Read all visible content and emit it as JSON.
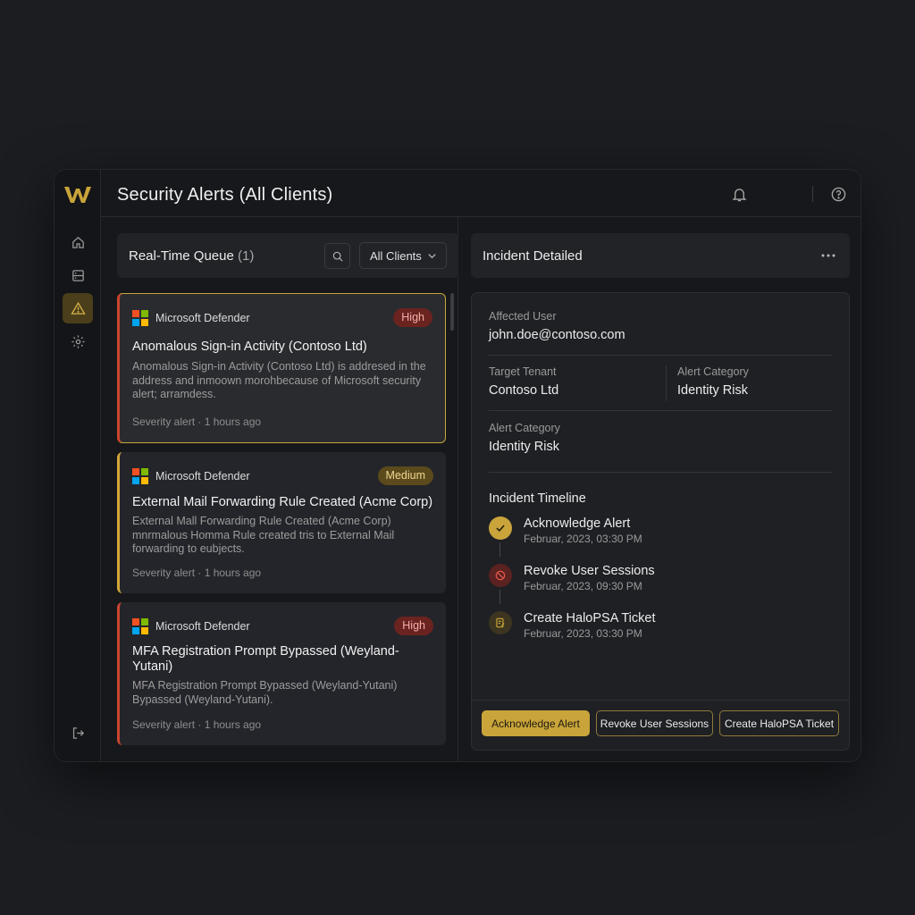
{
  "header": {
    "title": "Security Alerts (All Clients)"
  },
  "queue": {
    "title": "Real-Time Queue",
    "count": "(1)",
    "filter_value": "All Clients"
  },
  "alerts": [
    {
      "vendor": "Microsoft Defender",
      "severity": "High",
      "title": "Anomalous Sign-in Activity (Contoso Ltd)",
      "description": "Anomalous Sign-in Activity (Contoso Ltd) is addresed in the address and inmoown morohbecause of Microsoft security alert; arramdess.",
      "meta": "Severity alert · 1 hours ago"
    },
    {
      "vendor": "Microsoft Defender",
      "severity": "Medium",
      "title": "External Mail Forwarding Rule Created (Acme Corp)",
      "description": "External Mall Forwarding Rule Created (Acme Corp) mnrmalous Homma Rule created tris to External Mail forwarding to eubjects.",
      "meta": "Severity alert · 1 hours ago"
    },
    {
      "vendor": "Microsoft Defender",
      "severity": "High",
      "title": "MFA Registration Prompt Bypassed (Weyland-Yutani)",
      "description": "MFA Registration Prompt Bypassed (Weyland-Yutani) Bypassed (Weyland-Yutani).",
      "meta": "Severity alert · 1 hours ago"
    }
  ],
  "detail": {
    "title": "Incident Detailed",
    "affected_user_label": "Affected User",
    "affected_user": "john.doe@contoso.com",
    "target_tenant_label": "Target Tenant",
    "target_tenant": "Contoso Ltd",
    "alert_category_label": "Alert Category",
    "alert_category": "Identity Risk",
    "alert_category_label_2": "Alert Category",
    "alert_category_2": "Identity Risk",
    "timeline_title": "Incident Timeline",
    "timeline": [
      {
        "title": "Acknowledge Alert",
        "date": "Februar, 2023, 03:30 PM",
        "icon": "check-icon"
      },
      {
        "title": "Revoke User Sessions",
        "date": "Februar, 2023, 09:30 PM",
        "icon": "block-icon"
      },
      {
        "title": "Create HaloPSA Ticket",
        "date": "Februar, 2023, 03:30 PM",
        "icon": "ticket-icon"
      }
    ],
    "actions": {
      "acknowledge": "Acknowledge Alert",
      "revoke": "Revoke User Sessions",
      "ticket": "Create HaloPSA Ticket"
    }
  },
  "colors": {
    "accent": "#c9a43a",
    "high": "#c9452f",
    "medium": "#d4a73a",
    "background": "#1b1d21"
  }
}
